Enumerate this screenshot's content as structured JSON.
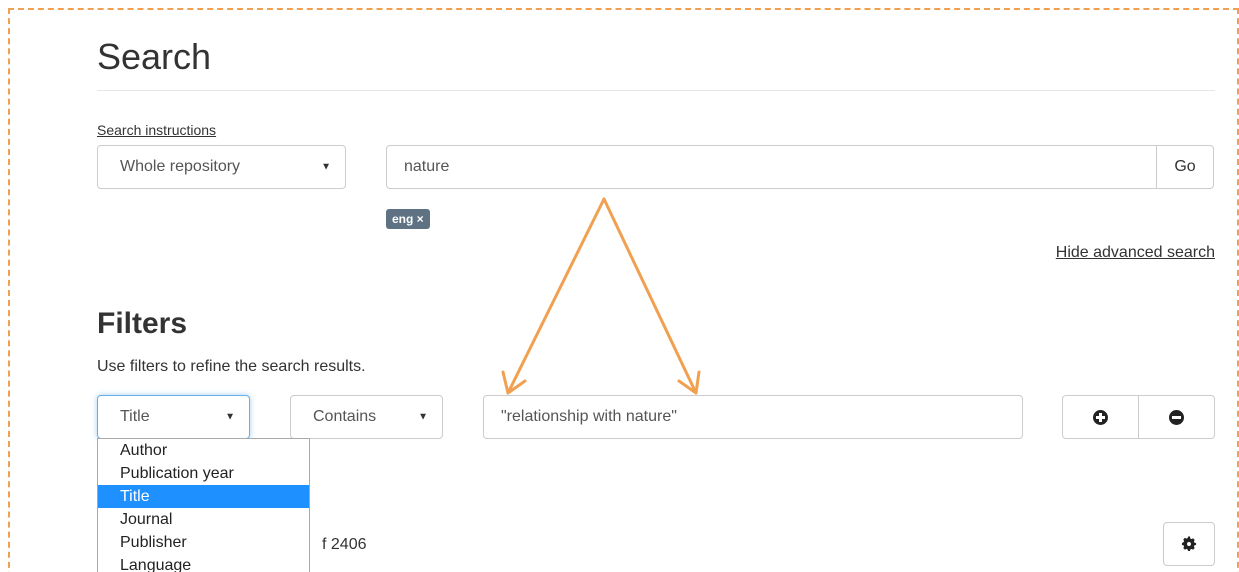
{
  "page": {
    "title": "Search"
  },
  "search": {
    "instructions_link": "Search instructions",
    "scope_select": {
      "selected": "Whole repository"
    },
    "query": "nature",
    "go_label": "Go",
    "tags": [
      {
        "label": "eng ×"
      }
    ],
    "advanced_toggle": "Hide advanced search"
  },
  "filters": {
    "title": "Filters",
    "help": "Use filters to refine the search results.",
    "field_select": {
      "selected": "Title"
    },
    "operator_select": {
      "selected": "Contains"
    },
    "value": "\"relationship with nature\"",
    "add_icon": "plus-circle-icon",
    "remove_icon": "minus-circle-icon",
    "field_options": [
      "Author",
      "Publication year",
      "Title",
      "Journal",
      "Publisher",
      "Language"
    ],
    "selected_option": "Title"
  },
  "results": {
    "count_fragment": "f 2406",
    "settings_icon": "gear-icon"
  },
  "colors": {
    "annotation": "#f0a050",
    "accent": "#1e90ff",
    "tag_bg": "#5e7283",
    "focus": "#66afe9"
  }
}
